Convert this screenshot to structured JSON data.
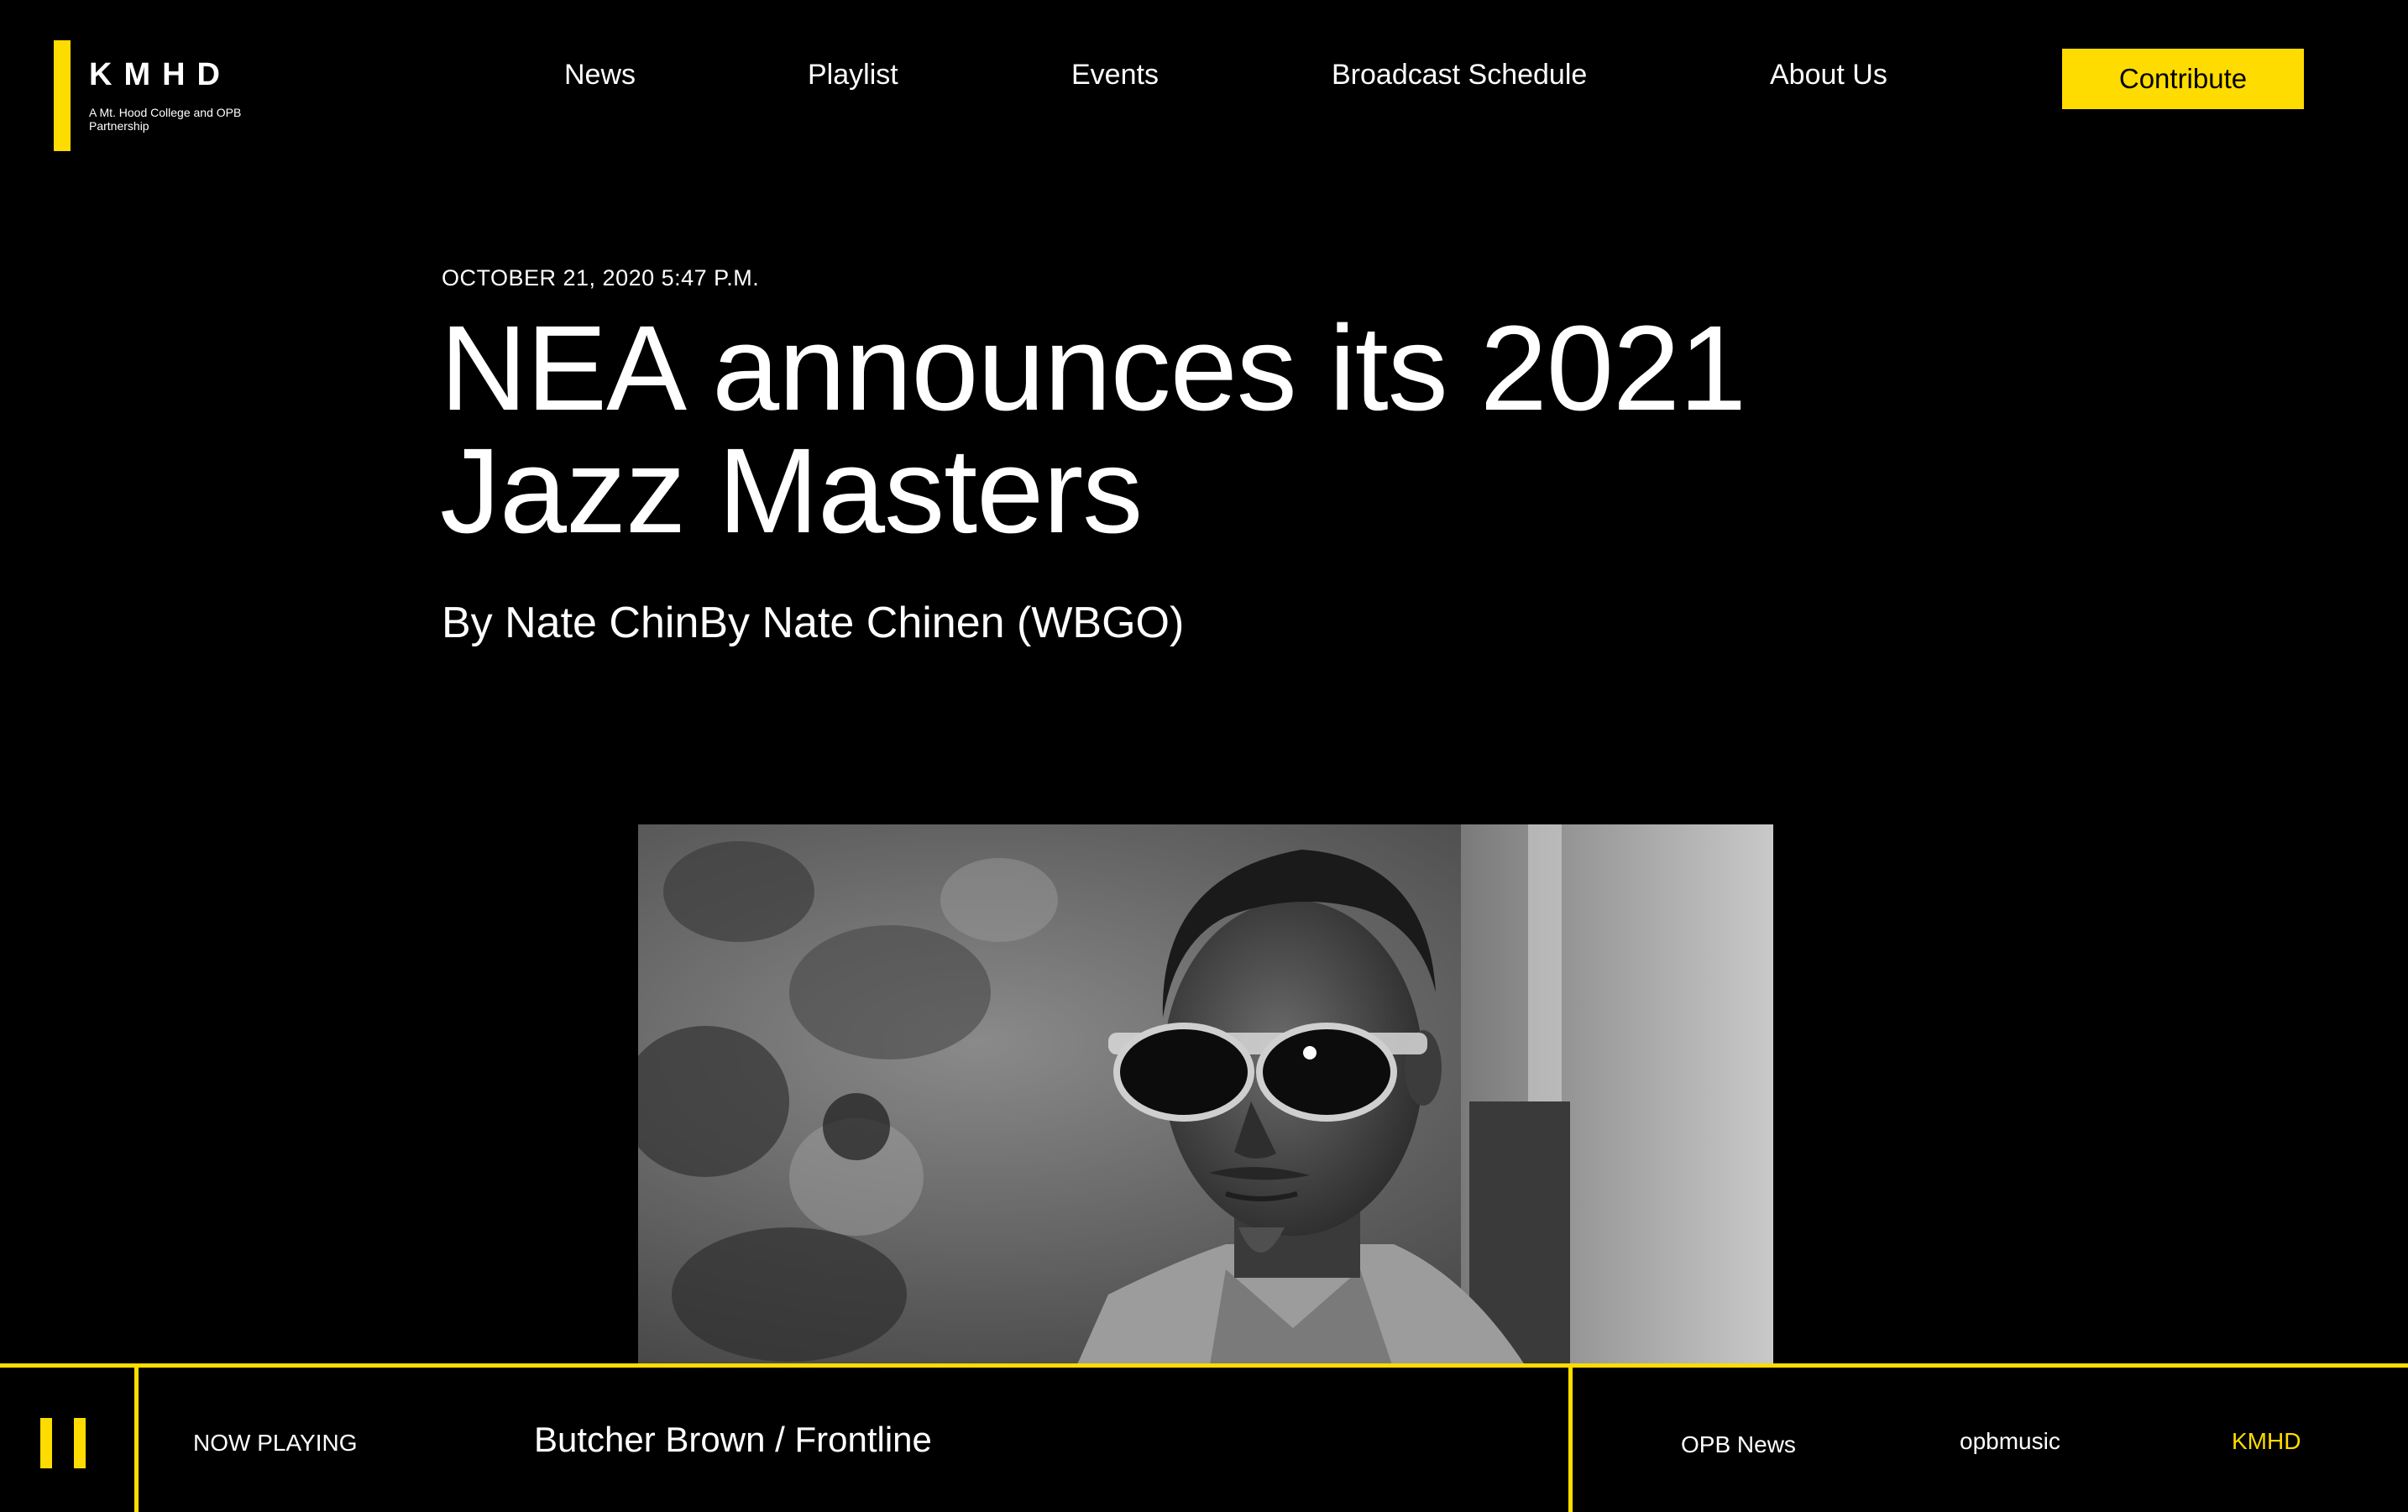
{
  "header": {
    "logo": {
      "word": "KMHD",
      "tagline": "A Mt. Hood College and OPB Partnership"
    },
    "nav": [
      "News",
      "Playlist",
      "Events",
      "Broadcast Schedule",
      "About Us"
    ],
    "contribute_label": "Contribute"
  },
  "article": {
    "dateline": "OCTOBER 21, 2020 5:47 P.M.",
    "headline_line1": "NEA announces its 2021",
    "headline_line2": "Jazz Masters",
    "byline": "By Nate ChinBy Nate Chinen (WBGO)",
    "photo_alt": "Black and white portrait of a man wearing sunglasses"
  },
  "player": {
    "now_playing_label": "NOW PLAYING",
    "track": "Butcher Brown / Frontline",
    "stations": [
      "OPB News",
      "opbmusic",
      "KMHD"
    ],
    "active_station": "KMHD"
  },
  "colors": {
    "accent": "#ffdc00",
    "background": "#000000",
    "text": "#ffffff"
  },
  "icons": {
    "pause": "pause-icon"
  }
}
